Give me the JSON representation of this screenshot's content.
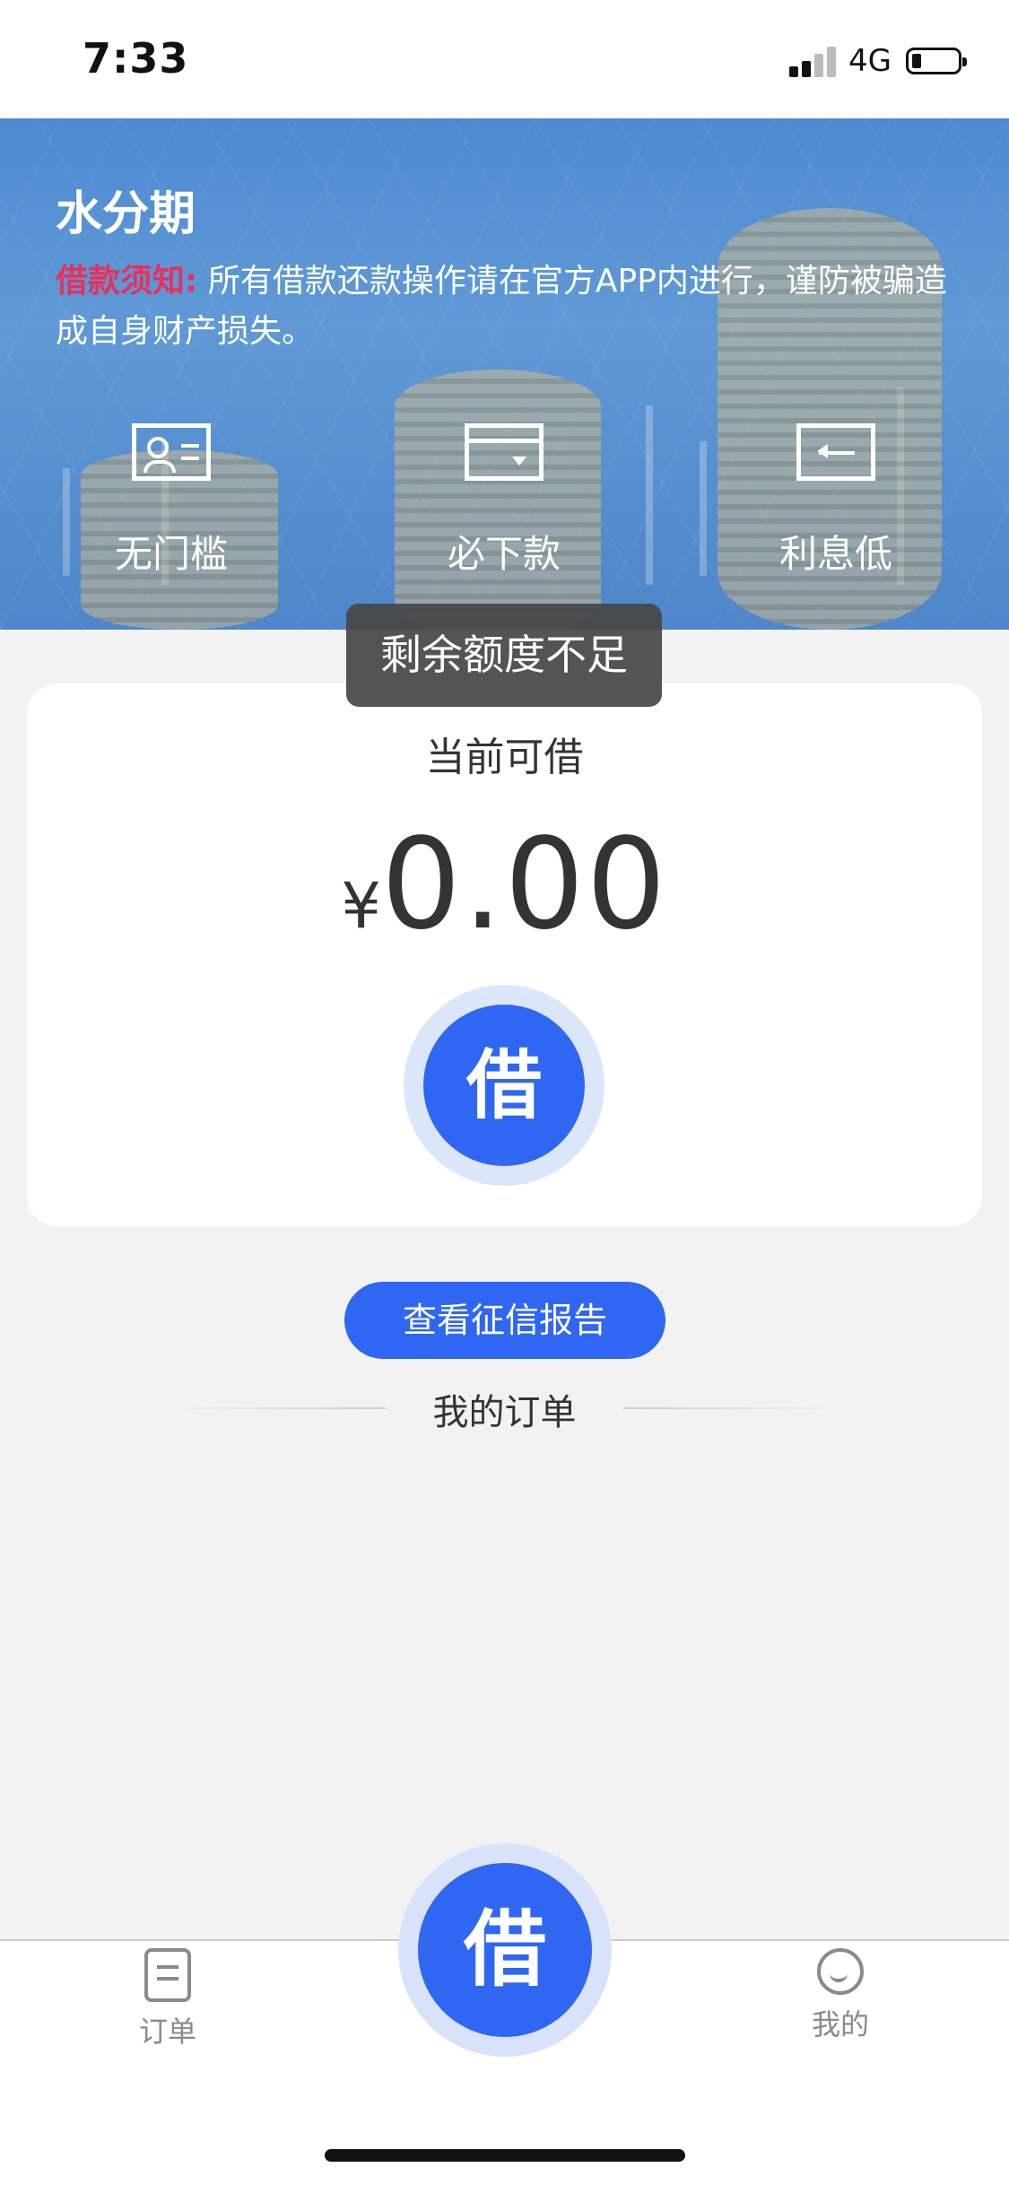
{
  "status_bar": {
    "time": "7:33",
    "network": "4G"
  },
  "banner": {
    "app_title": "水分期",
    "notice_label": "借款须知:",
    "notice_text": "所有借款还款操作请在官方APP内进行，谨防被骗造成自身财产损失。",
    "features": [
      {
        "icon": "id-card-icon",
        "label": "无门槛"
      },
      {
        "icon": "wallet-icon",
        "label": "必下款"
      },
      {
        "icon": "interest-icon",
        "label": "利息低"
      }
    ]
  },
  "toast": "剩余额度不足",
  "card": {
    "title": "当前可借",
    "currency": "¥",
    "amount": "0.00",
    "borrow_button": "借"
  },
  "credit_report_button": "查看征信报告",
  "orders_title": "我的订单",
  "tabbar": {
    "orders_label": "订单",
    "center_label": "借",
    "mine_label": "我的"
  },
  "colors": {
    "primary": "#2f66f2",
    "notice": "#e8305a",
    "banner": "#4d8ad0"
  }
}
